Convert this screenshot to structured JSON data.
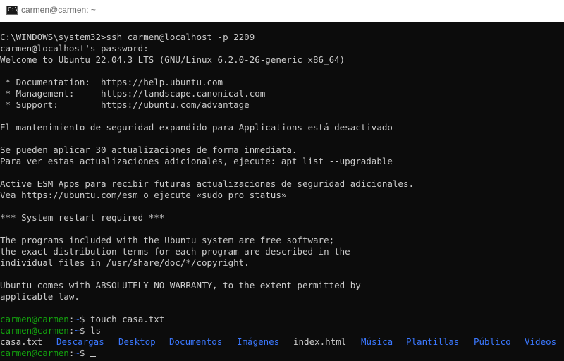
{
  "window": {
    "title": "carmen@carmen: ~",
    "icon": "terminal-icon",
    "icon_glyph": "C:\\",
    "background": "#0c0c0c",
    "text_color": "#cccccc",
    "prompt_color": "#13a10e",
    "dir_color": "#3b78ff"
  },
  "terminal": {
    "lines": [
      "C:\\WINDOWS\\system32>ssh carmen@localhost -p 2209",
      "carmen@localhost's password:",
      "Welcome to Ubuntu 22.04.3 LTS (GNU/Linux 6.2.0-26-generic x86_64)",
      "",
      " * Documentation:  https://help.ubuntu.com",
      " * Management:     https://landscape.canonical.com",
      " * Support:        https://ubuntu.com/advantage",
      "",
      "El mantenimiento de seguridad expandido para Applications está desactivado",
      "",
      "Se pueden aplicar 30 actualizaciones de forma inmediata.",
      "Para ver estas actualizaciones adicionales, ejecute: apt list --upgradable",
      "",
      "Active ESM Apps para recibir futuras actualizaciones de seguridad adicionales.",
      "Vea https://ubuntu.com/esm o ejecute «sudo pro status»",
      "",
      "*** System restart required ***",
      "",
      "The programs included with the Ubuntu system are free software;",
      "the exact distribution terms for each program are described in the",
      "individual files in /usr/share/doc/*/copyright.",
      "",
      "Ubuntu comes with ABSOLUTELY NO WARRANTY, to the extent permitted by",
      "applicable law.",
      ""
    ],
    "prompt_user": "carmen@carmen",
    "prompt_sep": ":",
    "prompt_path": "~",
    "prompt_symbol": "$ ",
    "commands": [
      "touch casa.txt",
      "ls"
    ],
    "ls_output": [
      {
        "name": "casa.txt",
        "type": "file"
      },
      {
        "name": "Descargas",
        "type": "dir"
      },
      {
        "name": "Desktop",
        "type": "dir"
      },
      {
        "name": "Documentos",
        "type": "dir"
      },
      {
        "name": "Imágenes",
        "type": "dir"
      },
      {
        "name": "index.html",
        "type": "file"
      },
      {
        "name": "Música",
        "type": "dir"
      },
      {
        "name": "Plantillas",
        "type": "dir"
      },
      {
        "name": "Público",
        "type": "dir"
      },
      {
        "name": "Vídeos",
        "type": "dir"
      }
    ]
  }
}
